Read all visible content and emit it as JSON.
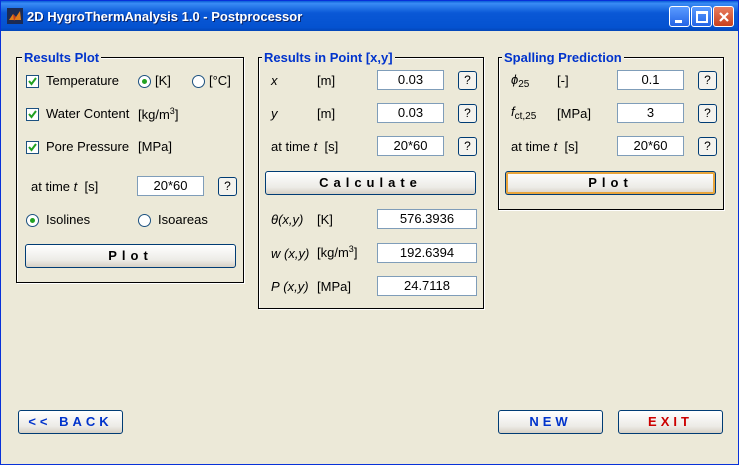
{
  "window": {
    "title": "2D HygroThermAnalysis 1.0 - Postprocessor"
  },
  "results_plot": {
    "title": "Results Plot",
    "temperature": {
      "label": "Temperature",
      "checked": true
    },
    "unit_k": {
      "label": "[K]",
      "selected": true
    },
    "unit_c": {
      "label": "[°C]",
      "selected": false
    },
    "water_content": {
      "label": "Water Content",
      "unit": "[kg/m",
      "unit_sup": "3",
      "unit_end": "]",
      "checked": true
    },
    "pore_pressure": {
      "label": "Pore Pressure",
      "unit": "[MPa]",
      "checked": true
    },
    "time_label": "at time",
    "time_var": "t",
    "time_unit": "[s]",
    "time_value": "20*60",
    "isolines": {
      "label": "Isolines",
      "selected": true
    },
    "isoareas": {
      "label": "Isoareas",
      "selected": false
    },
    "plot_button": "Plot",
    "help": "?"
  },
  "results_point": {
    "title": "Results in Point [x,y]",
    "x": {
      "label": "x",
      "unit": "[m]",
      "value": "0.03"
    },
    "y": {
      "label": "y",
      "unit": "[m]",
      "value": "0.03"
    },
    "time_label": "at time",
    "time_var": "t",
    "time_unit": "[s]",
    "time_value": "20*60",
    "calculate_button": "Calculate",
    "theta": {
      "symbol": "θ",
      "args": "(x,y)",
      "unit": "[K]",
      "value": "576.3936"
    },
    "w": {
      "symbol": "w",
      "args": "(x,y)",
      "unit": "[kg/m",
      "unit_sup": "3",
      "unit_end": "]",
      "value": "192.6394"
    },
    "p": {
      "symbol": "P",
      "args": "(x,y)",
      "unit": "[MPa]",
      "value": "24.7118"
    },
    "help": "?"
  },
  "spalling": {
    "title": "Spalling Prediction",
    "phi": {
      "symbol": "ϕ",
      "sub": "25",
      "unit": "[-]",
      "value": "0.1"
    },
    "fct": {
      "symbol": "f",
      "sub": "ct,25",
      "unit": "[MPa]",
      "value": "3"
    },
    "time_label": "at time",
    "time_var": "t",
    "time_unit": "[s]",
    "time_value": "20*60",
    "plot_button": "Plot",
    "help": "?"
  },
  "footer": {
    "back_button": "<< BACK",
    "new_button": "NEW",
    "exit_button": "EXIT"
  },
  "colors": {
    "title_blue": "#0033cc",
    "exit_red": "#cc0000",
    "check_green": "#21a121"
  },
  "icons": {
    "app": "matlab-icon",
    "minimize": "minimize-icon",
    "maximize": "maximize-icon",
    "close": "close-icon",
    "check": "checkmark-icon"
  }
}
